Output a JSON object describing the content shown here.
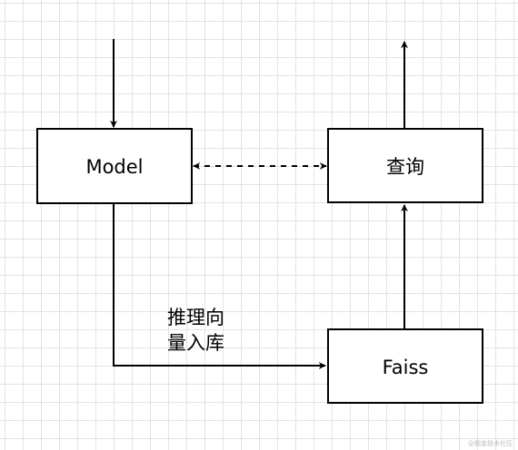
{
  "diagram": {
    "nodes": {
      "model": {
        "label": "Model"
      },
      "query": {
        "label": "查询"
      },
      "faiss": {
        "label": "Faiss"
      }
    },
    "edges": {
      "model_to_faiss": {
        "label": "推理向\n量入库"
      }
    }
  },
  "watermark": "@掘金技术社区",
  "colors": {
    "stroke": "#000000",
    "grid": "#e3e3e3",
    "background": "#ffffff"
  }
}
